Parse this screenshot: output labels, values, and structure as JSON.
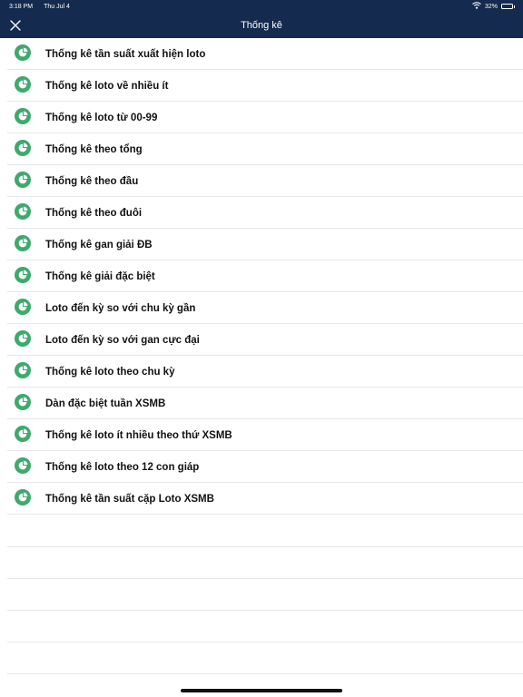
{
  "status_bar": {
    "time": "3:18 PM",
    "date": "Thu Jul 4",
    "battery_percent": "32%",
    "battery_level": 0.32,
    "wifi_icon": "wifi-icon"
  },
  "nav": {
    "title": "Thống kê",
    "close_icon": "close-icon"
  },
  "colors": {
    "nav_background": "#142a4f",
    "icon_green": "#3daa6b",
    "text": "#111111",
    "separator": "#e7e7ea"
  },
  "menu": {
    "icon": "pie-chart-icon",
    "items": [
      {
        "label": "Thống kê tần suất xuất hiện loto"
      },
      {
        "label": "Thống kê loto về nhiều ít"
      },
      {
        "label": "Thống kê loto từ 00-99"
      },
      {
        "label": "Thống kê theo tổng"
      },
      {
        "label": "Thống kê theo đầu"
      },
      {
        "label": "Thống kê theo đuôi"
      },
      {
        "label": "Thống kê gan giải ĐB"
      },
      {
        "label": "Thống kê giải đặc biệt"
      },
      {
        "label": "Loto đến kỳ so với chu kỳ gần"
      },
      {
        "label": "Loto đến kỳ so với gan cực đại"
      },
      {
        "label": "Thống kê loto theo chu kỳ"
      },
      {
        "label": "Dàn đặc biệt tuần XSMB"
      },
      {
        "label": "Thống kê loto ít nhiều theo thứ XSMB"
      },
      {
        "label": "Thống kê loto theo 12 con giáp"
      },
      {
        "label": "Thống kê tần suất cặp Loto XSMB"
      }
    ]
  }
}
